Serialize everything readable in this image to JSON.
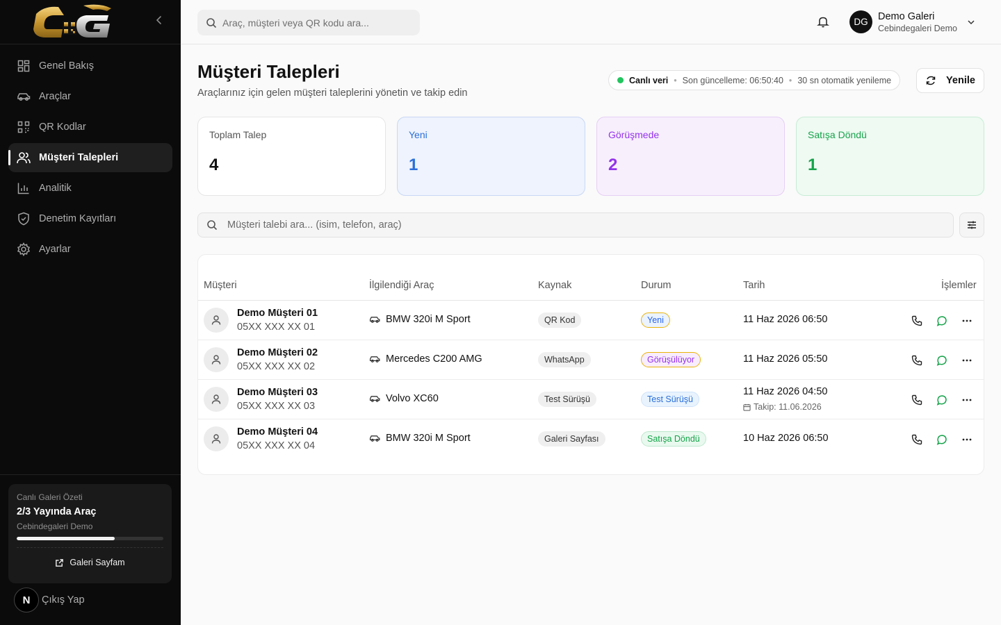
{
  "app": {
    "logo_text": "CG",
    "collapse_icon": "chevron-left-icon"
  },
  "sidebar": {
    "items": [
      {
        "label": "Genel Bakış",
        "icon": "grid-icon",
        "active": false
      },
      {
        "label": "Araçlar",
        "icon": "car-icon",
        "active": false
      },
      {
        "label": "QR Kodlar",
        "icon": "qr-code-icon",
        "active": false
      },
      {
        "label": "Müşteri Talepleri",
        "icon": "users-icon",
        "active": true
      },
      {
        "label": "Analitik",
        "icon": "bar-chart-icon",
        "active": false
      },
      {
        "label": "Denetim Kayıtları",
        "icon": "shield-icon",
        "active": false
      },
      {
        "label": "Ayarlar",
        "icon": "gear-icon",
        "active": false
      }
    ],
    "summary": {
      "label": "Canlı Galeri Özeti",
      "title": "2/3 Yayında Araç",
      "gallery": "Cebindegaleri Demo",
      "progress": 0.667,
      "link_label": "Galeri Sayfam"
    },
    "logout_label": "Çıkış Yap",
    "badge_letter": "N"
  },
  "topbar": {
    "search_placeholder": "Araç, müşteri veya QR kodu ara...",
    "user_initials": "DG",
    "user_name": "Demo Galeri",
    "user_sub": "Cebindegaleri Demo"
  },
  "page": {
    "title": "Müşteri Talepleri",
    "subtitle": "Araçlarınız için gelen müşteri taleplerini yönetin ve takip edin",
    "live": {
      "label": "Canlı veri",
      "last_update": "Son güncelleme: 06:50:40",
      "auto_refresh": "30 sn otomatik yenileme"
    },
    "refresh_label": "Yenile"
  },
  "stats": [
    {
      "label": "Toplam Talep",
      "value": "4"
    },
    {
      "label": "Yeni",
      "value": "1"
    },
    {
      "label": "Görüşmede",
      "value": "2"
    },
    {
      "label": "Satışa Döndü",
      "value": "1"
    }
  ],
  "search": {
    "placeholder": "Müşteri talebi ara... (isim, telefon, araç)"
  },
  "table": {
    "headers": {
      "customer": "Müşteri",
      "vehicle": "İlgilendiği Araç",
      "source": "Kaynak",
      "status": "Durum",
      "date": "Tarih",
      "actions": "İşlemler"
    },
    "rows": [
      {
        "name": "Demo Müşteri 01",
        "phone": "05XX XXX XX 01",
        "vehicle": "BMW 320i M Sport",
        "source": "QR Kod",
        "status": "Yeni",
        "status_color": "#2563eb",
        "date": "11 Haz 2026 06:50",
        "followup": ""
      },
      {
        "name": "Demo Müşteri 02",
        "phone": "05XX XXX XX 02",
        "vehicle": "Mercedes C200 AMG",
        "source": "WhatsApp",
        "status": "Görüşülüyor",
        "status_color": "#9333ea",
        "date": "11 Haz 2026 05:50",
        "followup": ""
      },
      {
        "name": "Demo Müşteri 03",
        "phone": "05XX XXX XX 03",
        "vehicle": "Volvo XC60",
        "source": "Test Sürüşü",
        "status": "Test Sürüşü",
        "status_color": "#2b6fd8",
        "date": "11 Haz 2026 04:50",
        "followup": "Takip: 11.06.2026"
      },
      {
        "name": "Demo Müşteri 04",
        "phone": "05XX XXX XX 04",
        "vehicle": "BMW 320i M Sport",
        "source": "Galeri Sayfası",
        "status": "Satışa Döndü",
        "status_color": "#16a34a",
        "date": "10 Haz 2026 06:50",
        "followup": ""
      }
    ]
  },
  "colors": {
    "accent_green": "#22c55e",
    "whatsapp_green": "#16a34a",
    "sidebar_bg": "#0b0b0b"
  }
}
